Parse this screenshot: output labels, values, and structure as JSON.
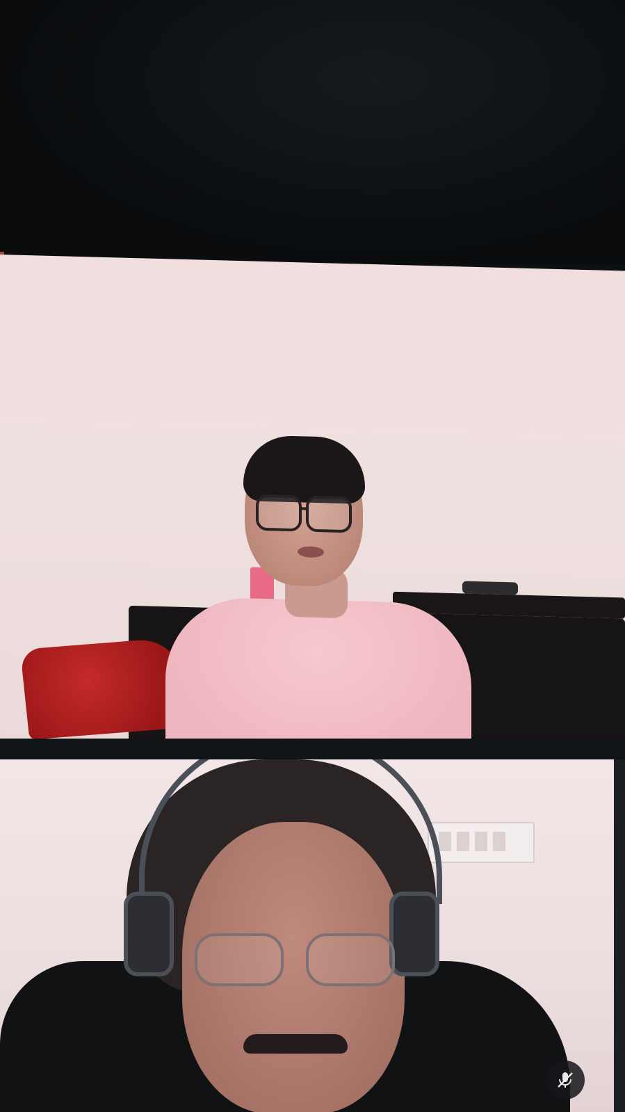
{
  "app": {
    "window_title": ""
  },
  "participants": [
    {
      "tile": "upper",
      "name_label": ""
    },
    {
      "tile": "lower",
      "name_label": "",
      "status_icon": "mic-muted-icon"
    }
  ],
  "colors": {
    "background": "#0b0d0f",
    "tile_wall": "#efe0e0",
    "shirt_pink": "#f6c8cf",
    "cushion_red": "#b42020"
  }
}
